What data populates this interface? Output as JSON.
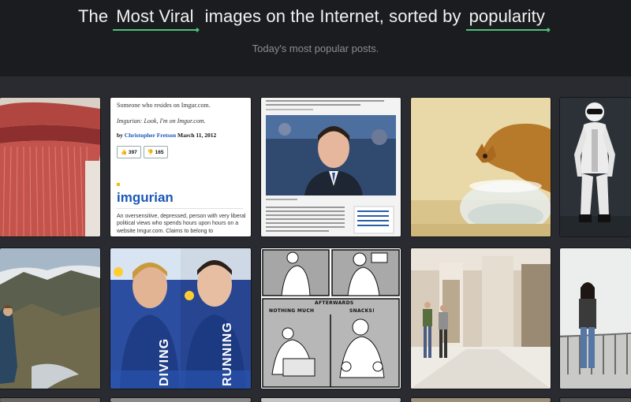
{
  "header": {
    "headline_prefix": "The",
    "highlight_1": "Most Viral",
    "headline_middle": "images on the Internet, sorted by",
    "highlight_2": "popularity",
    "subtitle": "Today's most popular posts.",
    "accent_color": "#4ec17a"
  },
  "tiles": {
    "dictionary": {
      "line1": "Someone who resides on Imgur.com.",
      "line2": "Imgurian: Look, I'm on Imgur.com.",
      "by": "by",
      "author": "Christopher Fretson",
      "date": "March 11, 2012",
      "upvotes": "397",
      "downvotes": "165",
      "word": "imgurian",
      "definition": "An oversensitive, depressed, person with very liberal political views who spends hours upon hours on a website Imgur.com. Claims to belong to"
    },
    "comic": {
      "caption_top": "AFTERWARDS",
      "caption_left": "NOTHING MUCH",
      "caption_right": "SNACKS!"
    },
    "sport": {
      "word_left": "DIVING",
      "word_right": "RUNNING"
    }
  }
}
